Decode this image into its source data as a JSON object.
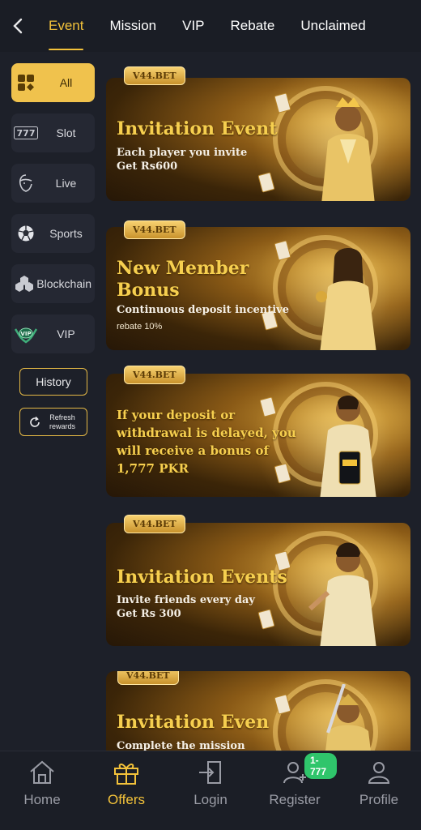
{
  "tabs": [
    {
      "label": "Event",
      "active": true
    },
    {
      "label": "Mission",
      "active": false
    },
    {
      "label": "VIP",
      "active": false
    },
    {
      "label": "Rebate",
      "active": false
    },
    {
      "label": "Unclaimed",
      "active": false
    }
  ],
  "categories": [
    {
      "label": "All",
      "icon": "grid-icon",
      "active": true
    },
    {
      "label": "Slot",
      "icon": "slot-777-icon",
      "active": false
    },
    {
      "label": "Live",
      "icon": "dealer-face-icon",
      "active": false
    },
    {
      "label": "Sports",
      "icon": "soccer-ball-icon",
      "active": false
    },
    {
      "label": "Blockchain",
      "icon": "blockchain-icon",
      "active": false
    },
    {
      "label": "VIP",
      "icon": "vip-badge-icon",
      "active": false
    }
  ],
  "history_label": "History",
  "refresh_label": "Refresh rewards",
  "banners": [
    {
      "brand": "V44.BET",
      "title": "Invitation Event",
      "lines": [
        "Each player you invite",
        "Get Rs600"
      ],
      "small": ""
    },
    {
      "brand": "V44.BET",
      "title": "New Member Bonus",
      "lines": [
        "Continuous deposit incentive"
      ],
      "small": "rebate 10%"
    },
    {
      "brand": "V44.BET",
      "title": "",
      "lines": [
        "If your deposit or",
        "withdrawal is delayed, you",
        "will receive a bonus of",
        "1,777 PKR"
      ],
      "small": ""
    },
    {
      "brand": "V44.BET",
      "title": "Invitation Events",
      "lines": [
        "Invite friends every day",
        "Get Rs 300"
      ],
      "small": ""
    },
    {
      "brand": "V44.BET",
      "title": "Invitation Even",
      "lines": [
        "Complete the mission"
      ],
      "small": ""
    }
  ],
  "bottom_nav": [
    {
      "label": "Home",
      "icon": "home-icon",
      "active": false
    },
    {
      "label": "Offers",
      "icon": "gift-icon",
      "active": true
    },
    {
      "label": "Login",
      "icon": "login-door-icon",
      "active": false
    },
    {
      "label": "Register",
      "icon": "add-user-icon",
      "active": false,
      "badge": "1-777"
    },
    {
      "label": "Profile",
      "icon": "person-icon",
      "active": false
    }
  ],
  "colors": {
    "accent": "#f3c23a",
    "background": "#1d2029",
    "badge": "#2fc56b"
  }
}
